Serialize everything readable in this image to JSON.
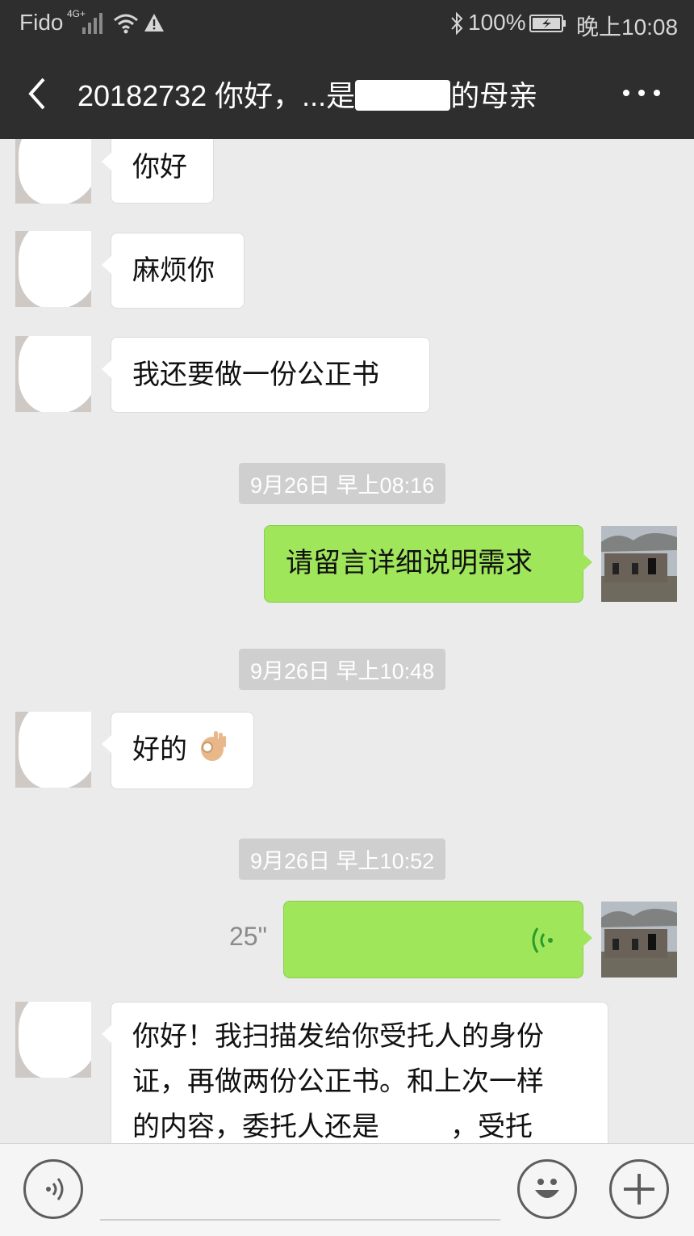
{
  "status_bar": {
    "carrier": "Fido",
    "network": "4G+",
    "battery_percent": "100%",
    "time": "晚上10:08"
  },
  "header": {
    "title_prefix": "20182732 你好，...是",
    "title_suffix": "的母亲"
  },
  "messages": [
    {
      "side": "in",
      "text": "你好"
    },
    {
      "side": "in",
      "text": "麻烦你"
    },
    {
      "side": "in",
      "text": "我还要做一份公正书"
    },
    {
      "timestamp": "9月26日 早上08:16"
    },
    {
      "side": "out",
      "text": "请留言详细说明需求"
    },
    {
      "timestamp": "9月26日 早上10:48"
    },
    {
      "side": "in",
      "text": "好的",
      "emoji": "ok-hand-icon"
    },
    {
      "timestamp": "9月26日 早上10:52"
    },
    {
      "side": "out",
      "type": "voice",
      "duration": "25\""
    },
    {
      "side": "in",
      "lines": [
        "你好！我扫描发给你受托人的身份",
        "证，再做两份公正书。和上次一样",
        "的内容，委托人还是",
        "，受托"
      ]
    }
  ],
  "icons": {
    "back": "chevron-left-icon",
    "more": "more-dots-icon",
    "voice_mode": "voice-mode-icon",
    "emoji": "emoji-icon",
    "add": "plus-icon"
  },
  "colors": {
    "header_bg": "#2e2e2e",
    "chat_bg": "#ebebeb",
    "outgoing_bubble": "#9fe65b",
    "incoming_bubble": "#ffffff"
  }
}
